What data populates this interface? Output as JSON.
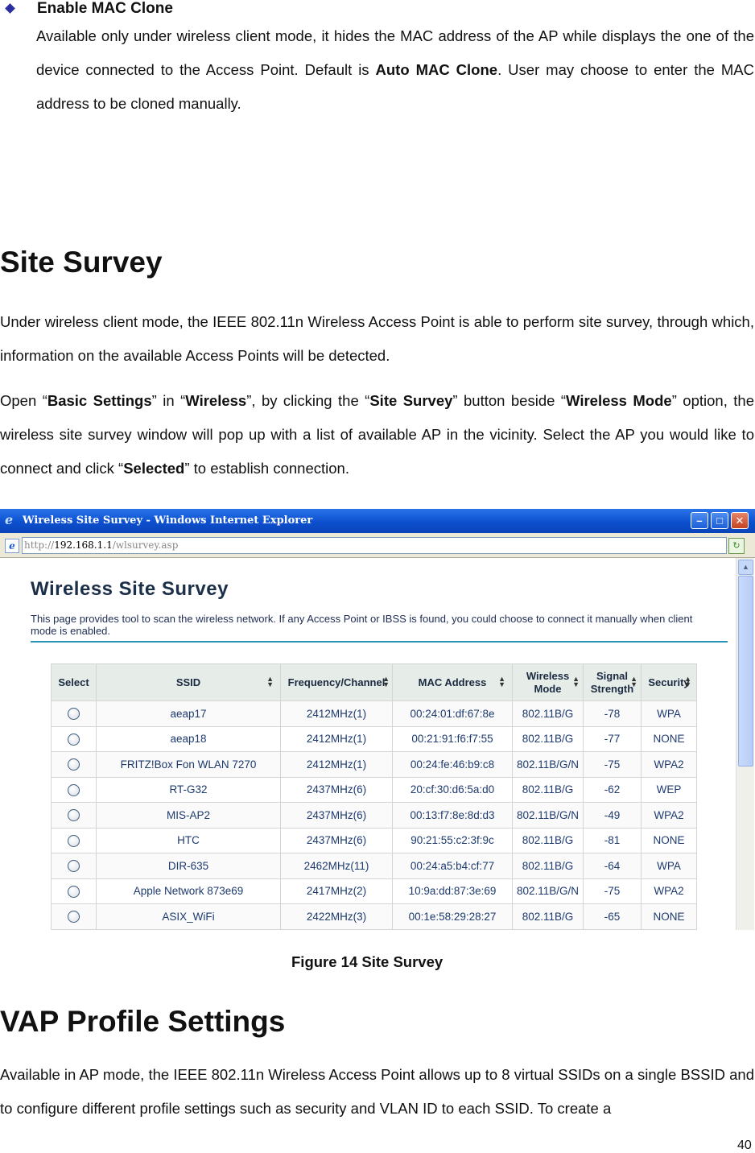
{
  "bullet": {
    "title": "Enable MAC Clone",
    "text_1": "Available only under wireless client mode, it hides the MAC address of the AP while displays the one of the device connected to the Access Point.  Default is ",
    "text_bold": "Auto MAC Clone",
    "text_2": ".  User may choose to enter the MAC address to be cloned manually."
  },
  "site_survey": {
    "heading": "Site Survey",
    "para1": "Under wireless client mode, the IEEE 802.11n Wireless Access Point is able to perform site survey, through which, information on the available Access Points will be detected.",
    "p2_a": "Open “",
    "p2_b": "Basic Settings",
    "p2_c": "” in “",
    "p2_d": "Wireless",
    "p2_e": "”, by clicking the “",
    "p2_f": "Site Survey",
    "p2_g": "” button beside “",
    "p2_h": "Wireless Mode",
    "p2_i": "” option, the wireless site survey window will pop up with a list of available AP in the vicinity.    Select the AP you would like to connect and click “",
    "p2_j": "Selected",
    "p2_k": "” to establish connection."
  },
  "window": {
    "title": "Wireless Site Survey - Windows Internet Explorer",
    "url_prefix": "http://",
    "url_host": "192.168.1.1",
    "url_path": "/wlsurvey.asp",
    "page_title": "Wireless Site Survey",
    "page_desc": "This page provides tool to scan the wireless network. If any Access Point or IBSS is found, you could choose to connect it manually when client mode is enabled.",
    "columns": {
      "select": "Select",
      "ssid": "SSID",
      "freq": "Frequency/Channel",
      "mac": "MAC Address",
      "mode_1": "Wireless",
      "mode_2": "Mode",
      "signal_1": "Signal",
      "signal_2": "Strength",
      "security": "Security"
    },
    "rows": [
      {
        "ssid": "aeap17",
        "freq": "2412MHz(1)",
        "mac": "00:24:01:df:67:8e",
        "mode": "802.11B/G",
        "signal": "-78",
        "security": "WPA"
      },
      {
        "ssid": "aeap18",
        "freq": "2412MHz(1)",
        "mac": "00:21:91:f6:f7:55",
        "mode": "802.11B/G",
        "signal": "-77",
        "security": "NONE"
      },
      {
        "ssid": "FRITZ!Box Fon WLAN 7270",
        "freq": "2412MHz(1)",
        "mac": "00:24:fe:46:b9:c8",
        "mode": "802.11B/G/N",
        "signal": "-75",
        "security": "WPA2"
      },
      {
        "ssid": "RT-G32",
        "freq": "2437MHz(6)",
        "mac": "20:cf:30:d6:5a:d0",
        "mode": "802.11B/G",
        "signal": "-62",
        "security": "WEP"
      },
      {
        "ssid": "MIS-AP2",
        "freq": "2437MHz(6)",
        "mac": "00:13:f7:8e:8d:d3",
        "mode": "802.11B/G/N",
        "signal": "-49",
        "security": "WPA2"
      },
      {
        "ssid": "HTC",
        "freq": "2437MHz(6)",
        "mac": "90:21:55:c2:3f:9c",
        "mode": "802.11B/G",
        "signal": "-81",
        "security": "NONE"
      },
      {
        "ssid": "DIR-635",
        "freq": "2462MHz(11)",
        "mac": "00:24:a5:b4:cf:77",
        "mode": "802.11B/G",
        "signal": "-64",
        "security": "WPA"
      },
      {
        "ssid": "Apple Network 873e69",
        "freq": "2417MHz(2)",
        "mac": "10:9a:dd:87:3e:69",
        "mode": "802.11B/G/N",
        "signal": "-75",
        "security": "WPA2"
      },
      {
        "ssid": "ASIX_WiFi",
        "freq": "2422MHz(3)",
        "mac": "00:1e:58:29:28:27",
        "mode": "802.11B/G",
        "signal": "-65",
        "security": "NONE"
      }
    ]
  },
  "figure_caption": "Figure 14 Site Survey",
  "vap": {
    "heading": "VAP Profile Settings",
    "para": "Available in AP mode, the IEEE 802.11n Wireless Access Point allows up to 8 virtual SSIDs on a single BSSID and to configure different profile settings such as security and VLAN ID to each SSID.    To create a"
  },
  "page_number": "40"
}
